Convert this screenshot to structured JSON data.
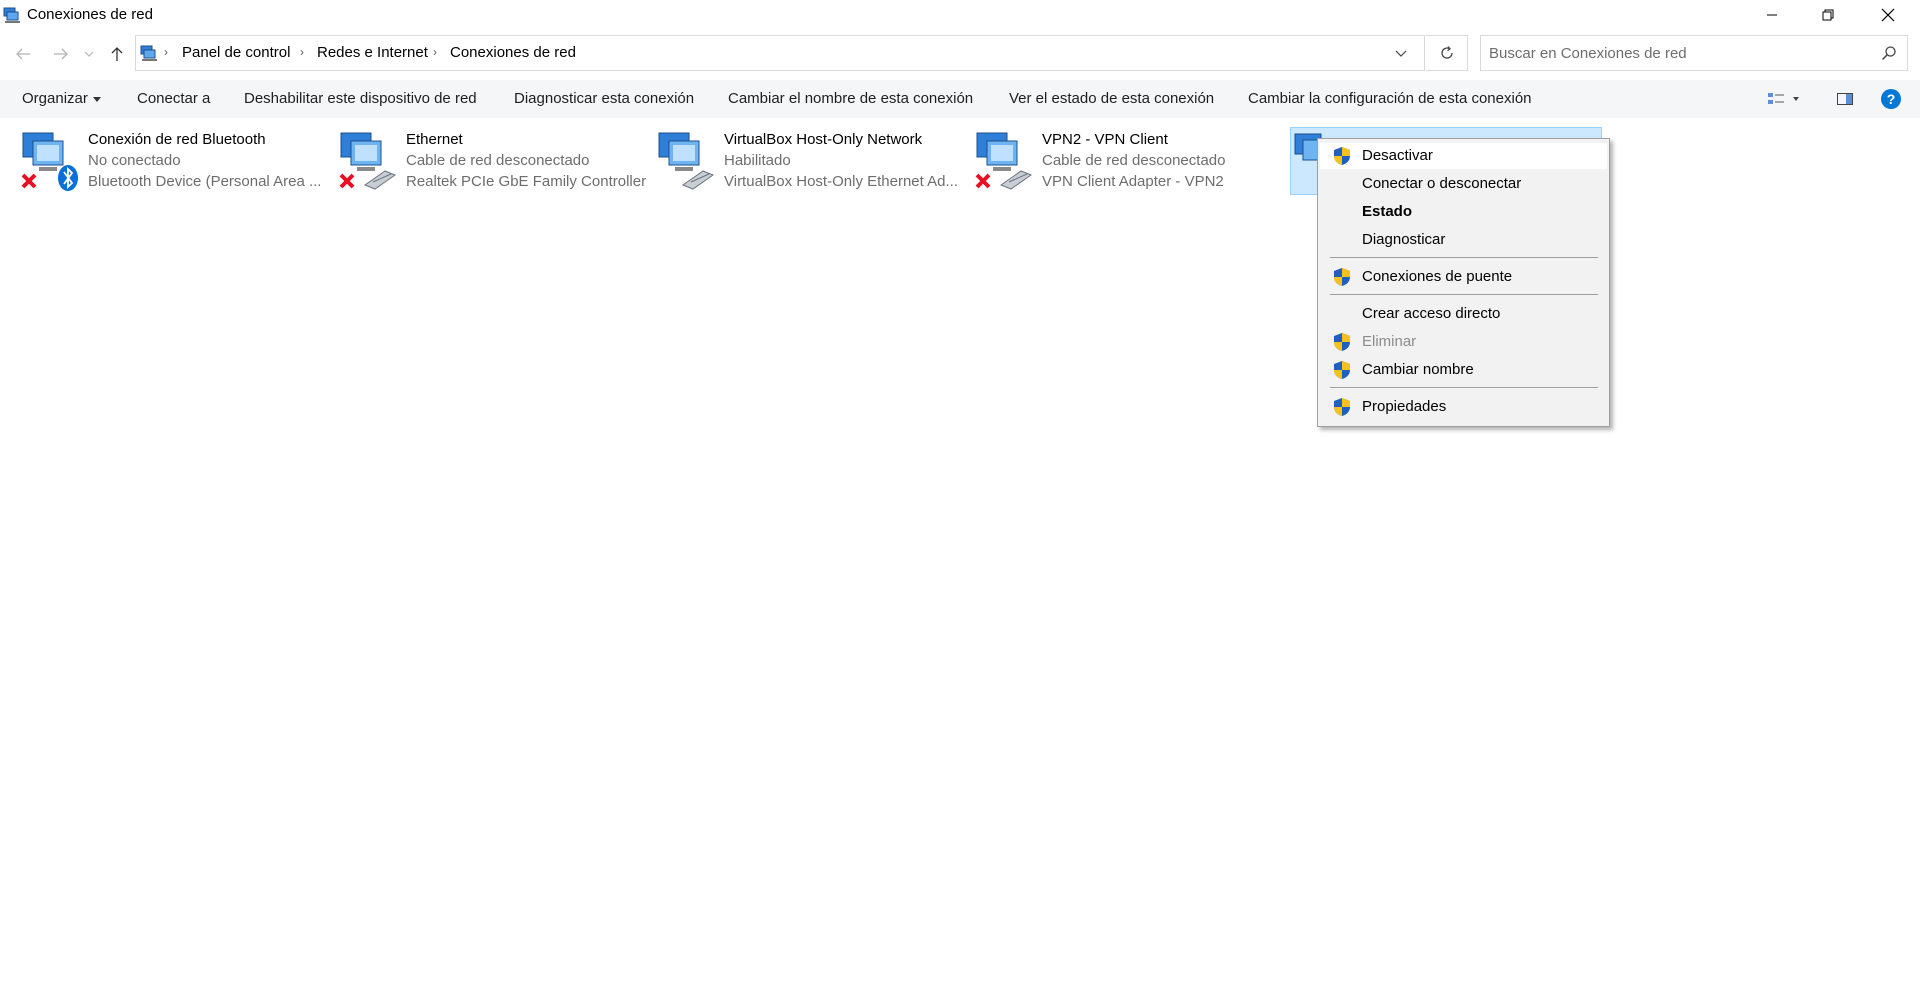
{
  "window": {
    "title": "Conexiones de red",
    "controls": {
      "minimize": "minimize-icon",
      "restore": "restore-icon",
      "close": "close-icon"
    }
  },
  "address": {
    "crumbs": [
      "Panel de control",
      "Redes e Internet",
      "Conexiones de red"
    ],
    "search_placeholder": "Buscar en Conexiones de red"
  },
  "toolbar": {
    "organize": "Organizar",
    "connect": "Conectar a",
    "disable": "Deshabilitar este dispositivo de red",
    "diagnose": "Diagnosticar esta conexión",
    "rename": "Cambiar el nombre de esta conexión",
    "status": "Ver el estado de esta conexión",
    "settings": "Cambiar la configuración de esta conexión"
  },
  "connections": [
    {
      "name": "Conexión de red Bluetooth",
      "status": "No conectado",
      "device": "Bluetooth Device (Personal Area ..."
    },
    {
      "name": "Ethernet",
      "status": "Cable de red desconectado",
      "device": "Realtek PCIe GbE Family Controller"
    },
    {
      "name": "VirtualBox Host-Only Network",
      "status": "Habilitado",
      "device": "VirtualBox Host-Only Ethernet Ad..."
    },
    {
      "name": "VPN2 - VPN Client",
      "status": "Cable de red desconectado",
      "device": "VPN Client Adapter - VPN2"
    }
  ],
  "context_menu": {
    "items": [
      {
        "label": "Desactivar",
        "shield": true
      },
      {
        "label": "Conectar o desconectar",
        "shield": false
      },
      {
        "label": "Estado",
        "shield": false,
        "bold": true
      },
      {
        "label": "Diagnosticar",
        "shield": false
      },
      {
        "label": "Conexiones de puente",
        "shield": true
      },
      {
        "label": "Crear acceso directo",
        "shield": false
      },
      {
        "label": "Eliminar",
        "shield": true,
        "disabled": true
      },
      {
        "label": "Cambiar nombre",
        "shield": true
      },
      {
        "label": "Propiedades",
        "shield": true
      }
    ]
  },
  "colors": {
    "accent": "#0078d7",
    "selection": "#cce8ff",
    "error_x": "#e81123",
    "toolbar_bg": "#f5f6f7",
    "menu_bg": "#f2f2f2"
  }
}
